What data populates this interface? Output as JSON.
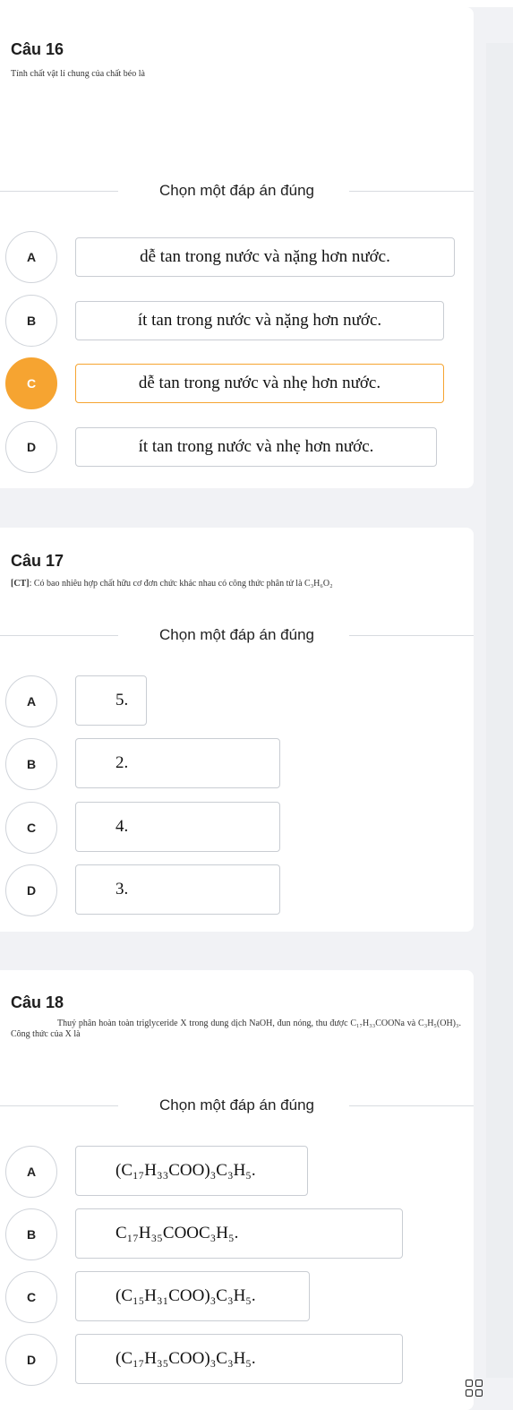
{
  "questions": [
    {
      "title": "Câu 16",
      "text": "Tính chất vật lí chung của chất béo là",
      "prompt": "Chọn một đáp án đúng",
      "options": [
        {
          "letter": "A",
          "text": "dễ tan trong nước và nặng hơn nước."
        },
        {
          "letter": "B",
          "text": "ít tan trong nước và nặng hơn nước."
        },
        {
          "letter": "C",
          "text": "dễ tan trong nước và nhẹ hơn nước.",
          "selected": true
        },
        {
          "letter": "D",
          "text": "ít tan trong nước và nhẹ hơn nước."
        }
      ]
    },
    {
      "title": "Câu 17",
      "text_prefix": "[CT]",
      "text": ": Có bao nhiêu hợp chất hữu cơ đơn chức khác nhau có công thức phân tử là C₃H₆O₂",
      "prompt": "Chọn một đáp án đúng",
      "options": [
        {
          "letter": "A",
          "text": "5."
        },
        {
          "letter": "B",
          "text": "2."
        },
        {
          "letter": "C",
          "text": "4."
        },
        {
          "letter": "D",
          "text": "3."
        }
      ]
    },
    {
      "title": "Câu 18",
      "text": "Thuỷ phân hoàn toàn triglyceride X trong dung dịch NaOH, đun nóng, thu được C₁₇H₃₃COONa và C₃H₅(OH)₃. Công thức của X là",
      "prompt": "Chọn một đáp án đúng",
      "options": [
        {
          "letter": "A",
          "text": "(C₁₇H₃₃COO)₃C₃H₅."
        },
        {
          "letter": "B",
          "text": "C₁₇H₃₅COOC₃H₅."
        },
        {
          "letter": "C",
          "text": "(C₁₅H₃₁COO)₃C₃H₅."
        },
        {
          "letter": "D",
          "text": "(C₁₇H₃₅COO)₃C₃H₅."
        }
      ]
    }
  ],
  "icons": {
    "corner": "grid-icon"
  },
  "colors": {
    "selected": "#f6a431"
  }
}
